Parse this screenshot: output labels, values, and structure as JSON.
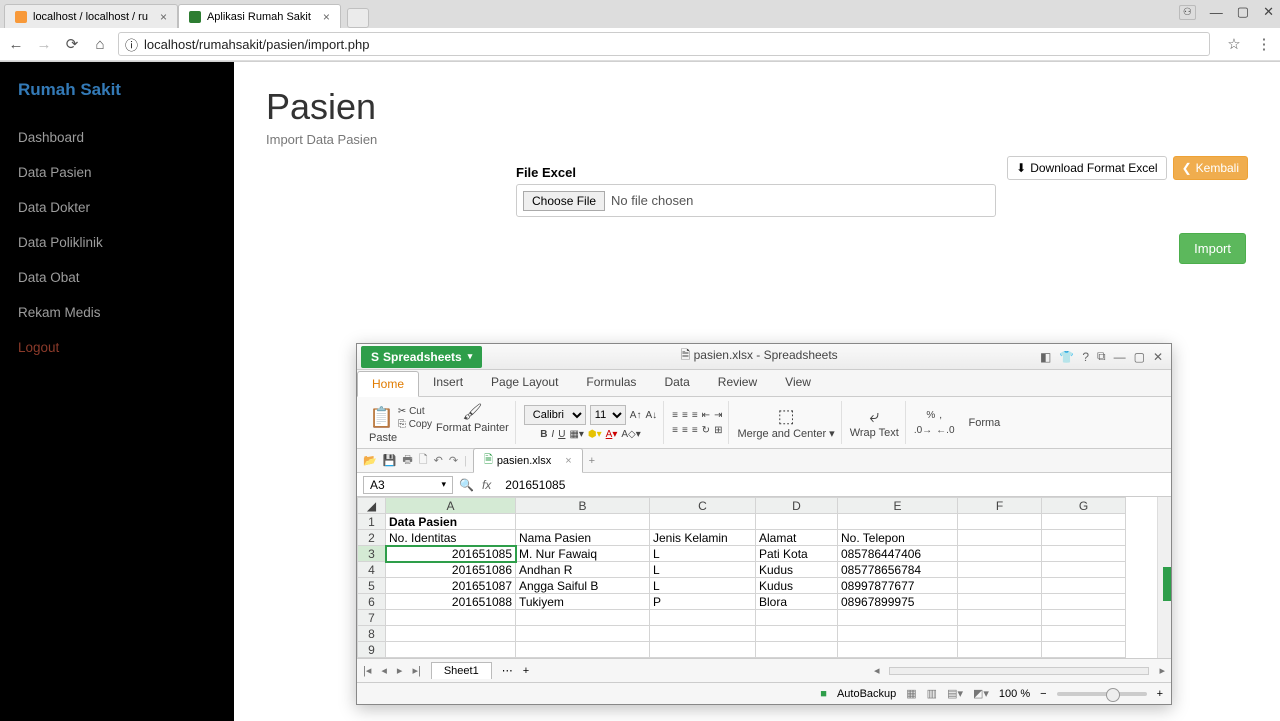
{
  "browser": {
    "tabs": [
      {
        "title": "localhost / localhost / ru",
        "favicon": "pma"
      },
      {
        "title": "Aplikasi Rumah Sakit",
        "favicon": "ci",
        "active": true
      }
    ],
    "url_prefix": "ⓘ",
    "url": "localhost/rumahsakit/pasien/import.php"
  },
  "sidebar": {
    "brand": "Rumah Sakit",
    "items": [
      "Dashboard",
      "Data Pasien",
      "Data Dokter",
      "Data Poliklinik",
      "Data Obat",
      "Rekam Medis"
    ],
    "logout": "Logout"
  },
  "page": {
    "title": "Pasien",
    "subtitle": "Import Data Pasien",
    "btn_download": "Download Format Excel",
    "btn_back": "Kembali",
    "file_label": "File Excel",
    "choose_file": "Choose File",
    "no_file": "No file chosen",
    "btn_import": "Import"
  },
  "spreadsheet": {
    "app_name": "Spreadsheets",
    "window_title": "pasien.xlsx - Spreadsheets",
    "menus": [
      "Home",
      "Insert",
      "Page Layout",
      "Formulas",
      "Data",
      "Review",
      "View"
    ],
    "active_menu": "Home",
    "ribbon": {
      "cut": "Cut",
      "copy": "Copy",
      "paste": "Paste",
      "format_painter": "Format Painter",
      "font": "Calibri",
      "size": "11",
      "merge": "Merge and Center",
      "wrap": "Wrap Text",
      "format": "Forma"
    },
    "doc_tab": "pasien.xlsx",
    "cell_ref": "A3",
    "formula_value": "201651085",
    "columns": [
      "A",
      "B",
      "C",
      "D",
      "E",
      "F",
      "G"
    ],
    "header_row": "Data Pasien",
    "sub_headers": [
      "No. Identitas",
      "Nama Pasien",
      "Jenis Kelamin",
      "Alamat",
      "No. Telepon"
    ],
    "rows": [
      [
        "201651085",
        "M. Nur Fawaiq",
        "L",
        "Pati Kota",
        "085786447406"
      ],
      [
        "201651086",
        "Andhan R",
        "L",
        "Kudus",
        "085778656784"
      ],
      [
        "201651087",
        "Angga Saiful B",
        "L",
        "Kudus",
        "08997877677"
      ],
      [
        "201651088",
        "Tukiyem",
        "P",
        "Blora",
        "08967899975"
      ]
    ],
    "sheet_name": "Sheet1",
    "status": {
      "autobackup": "AutoBackup",
      "zoom": "100 %"
    }
  },
  "chart_data": {
    "type": "table",
    "title": "Data Pasien",
    "columns": [
      "No. Identitas",
      "Nama Pasien",
      "Jenis Kelamin",
      "Alamat",
      "No. Telepon"
    ],
    "rows": [
      [
        201651085,
        "M. Nur Fawaiq",
        "L",
        "Pati Kota",
        "085786447406"
      ],
      [
        201651086,
        "Andhan R",
        "L",
        "Kudus",
        "085778656784"
      ],
      [
        201651087,
        "Angga Saiful B",
        "L",
        "Kudus",
        "08997877677"
      ],
      [
        201651088,
        "Tukiyem",
        "P",
        "Blora",
        "08967899975"
      ]
    ]
  }
}
